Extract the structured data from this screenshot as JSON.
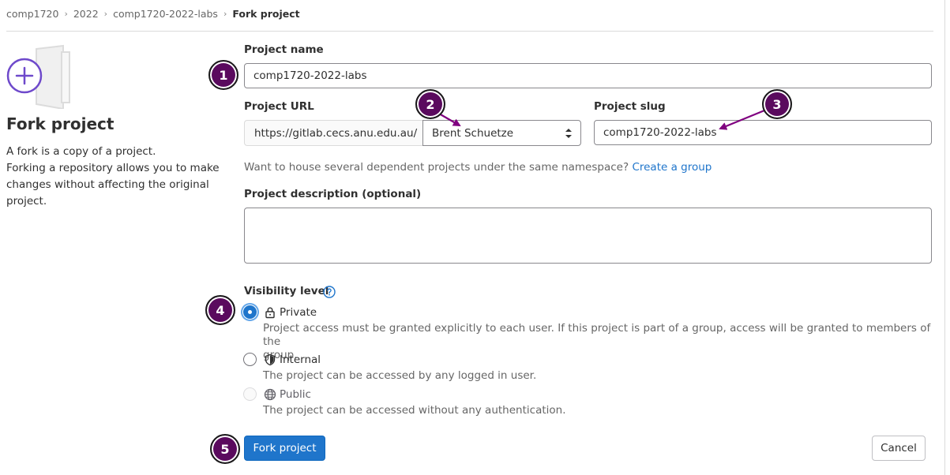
{
  "breadcrumb": {
    "items": [
      "comp1720",
      "2022",
      "comp1720-2022-labs"
    ],
    "current": "Fork project",
    "separator": "›"
  },
  "left": {
    "title": "Fork project",
    "desc_line1": "A fork is a copy of a project.",
    "desc_line2": "Forking a repository allows you to make changes without affecting the original project."
  },
  "form": {
    "project_name_label": "Project name",
    "project_name_value": "comp1720-2022-labs",
    "project_url_label": "Project URL",
    "url_prefix": "https://gitlab.cecs.anu.edu.au/",
    "namespace_value": "Brent Schuetze",
    "project_slug_label": "Project slug",
    "project_slug_value": "comp1720-2022-labs",
    "help_text": "Want to house several dependent projects under the same namespace?",
    "help_link": "Create a group",
    "description_label": "Project description (optional)",
    "description_value": "",
    "visibility_label": "Visibility level",
    "visibility_options": [
      {
        "label": "Private",
        "icon": "lock-icon",
        "checked": true,
        "desc_line1": "Project access must be granted explicitly to each user. If this project is part of a group, access will be granted to members of the",
        "desc_line2": "group."
      },
      {
        "label": "Internal",
        "icon": "shield-icon",
        "checked": false,
        "desc_line1": "The project can be accessed by any logged in user."
      },
      {
        "label": "Public",
        "icon": "globe-icon",
        "checked": false,
        "disabled": true,
        "desc_line1": "The project can be accessed without any authentication."
      }
    ]
  },
  "buttons": {
    "fork_label": "Fork project",
    "cancel_label": "Cancel"
  },
  "annotations": {
    "badges": [
      "1",
      "2",
      "3",
      "4",
      "5"
    ],
    "color": "#5a0a5e"
  },
  "colors": {
    "primary": "#1f75cb",
    "text": "#303030",
    "muted": "#666666",
    "annotation": "#800080"
  }
}
